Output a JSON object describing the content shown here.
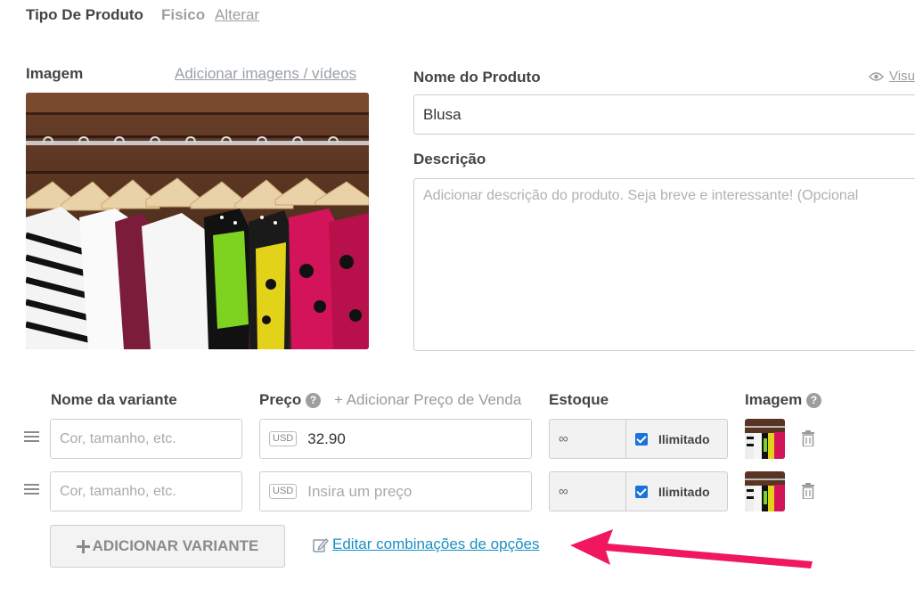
{
  "product_type": {
    "label": "Tipo De Produto",
    "value": "Fisico",
    "change_link": "Alterar"
  },
  "image_section": {
    "label": "Imagem",
    "add_link": "Adicionar imagens / vídeos"
  },
  "name": {
    "label": "Nome do Produto",
    "value": "Blusa",
    "preview_link": "Visu"
  },
  "description": {
    "label": "Descrição",
    "placeholder": "Adicionar descrição do produto. Seja breve e interessante! (Opcional"
  },
  "variants": {
    "headers": {
      "name": "Nome da variante",
      "price": "Preço",
      "add_sale_price": "+ Adicionar Preço de Venda",
      "stock": "Estoque",
      "image": "Imagem"
    },
    "rows": [
      {
        "name_placeholder": "Cor, tamanho, etc.",
        "currency": "USD",
        "price": "32.90",
        "price_placeholder": "",
        "stock": "∞",
        "unlimited_label": "Ilimitado",
        "unlimited_checked": true
      },
      {
        "name_placeholder": "Cor, tamanho, etc.",
        "currency": "USD",
        "price": "",
        "price_placeholder": "Insira um preço",
        "stock": "∞",
        "unlimited_label": "Ilimitado",
        "unlimited_checked": true
      }
    ],
    "add_button": "ADICIONAR VARIANTE",
    "edit_combinations_link": "Editar combinações de opções"
  },
  "colors": {
    "accent_link": "#1a8fc4",
    "arrow": "#f0175f",
    "checkbox": "#1a73d9"
  },
  "icons": [
    "eye-icon",
    "drag-handle-icon",
    "help-icon",
    "trash-icon",
    "edit-icon",
    "plus-icon",
    "arrow-annotation"
  ]
}
